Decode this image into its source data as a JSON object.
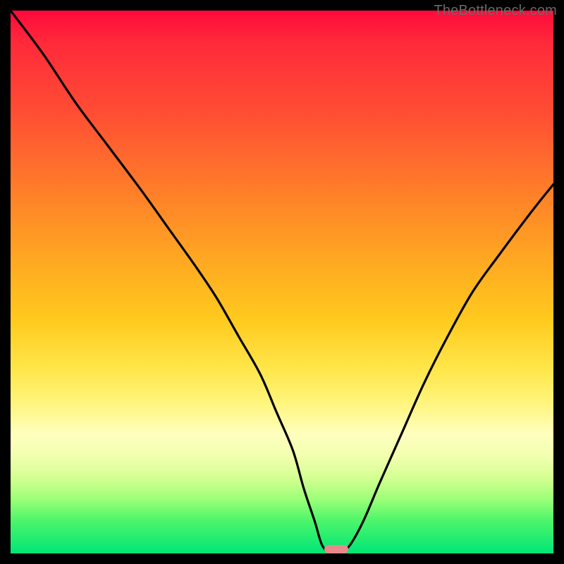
{
  "watermark": "TheBottleneck.com",
  "chart_data": {
    "type": "line",
    "title": "",
    "xlabel": "",
    "ylabel": "",
    "xlim": [
      0,
      100
    ],
    "ylim": [
      0,
      100
    ],
    "series": [
      {
        "name": "curve",
        "x": [
          0,
          6,
          12,
          18,
          24,
          29,
          34,
          38,
          42,
          46,
          49,
          52,
          54,
          56,
          57.4,
          59,
          60.6,
          62.5,
          65,
          68,
          72,
          76,
          80,
          85,
          90,
          96,
          100
        ],
        "y": [
          100,
          92,
          83,
          75,
          67,
          60,
          53,
          47,
          40,
          33,
          26,
          19,
          12,
          6,
          1.5,
          0,
          0,
          1.5,
          6,
          13,
          22,
          31,
          39,
          48,
          55,
          63,
          68
        ]
      }
    ],
    "marker": {
      "x": 60,
      "y": 0.8,
      "shape": "pill",
      "color": "#e88a8a"
    },
    "background_gradient": {
      "direction": "top-to-bottom",
      "stops": [
        {
          "pos": 0,
          "color": "#ff0a3c"
        },
        {
          "pos": 18,
          "color": "#ff4b34"
        },
        {
          "pos": 45,
          "color": "#ffa522"
        },
        {
          "pos": 66,
          "color": "#ffe64a"
        },
        {
          "pos": 78,
          "color": "#ffffbe"
        },
        {
          "pos": 90,
          "color": "#9cff78"
        },
        {
          "pos": 100,
          "color": "#00e676"
        }
      ]
    }
  }
}
